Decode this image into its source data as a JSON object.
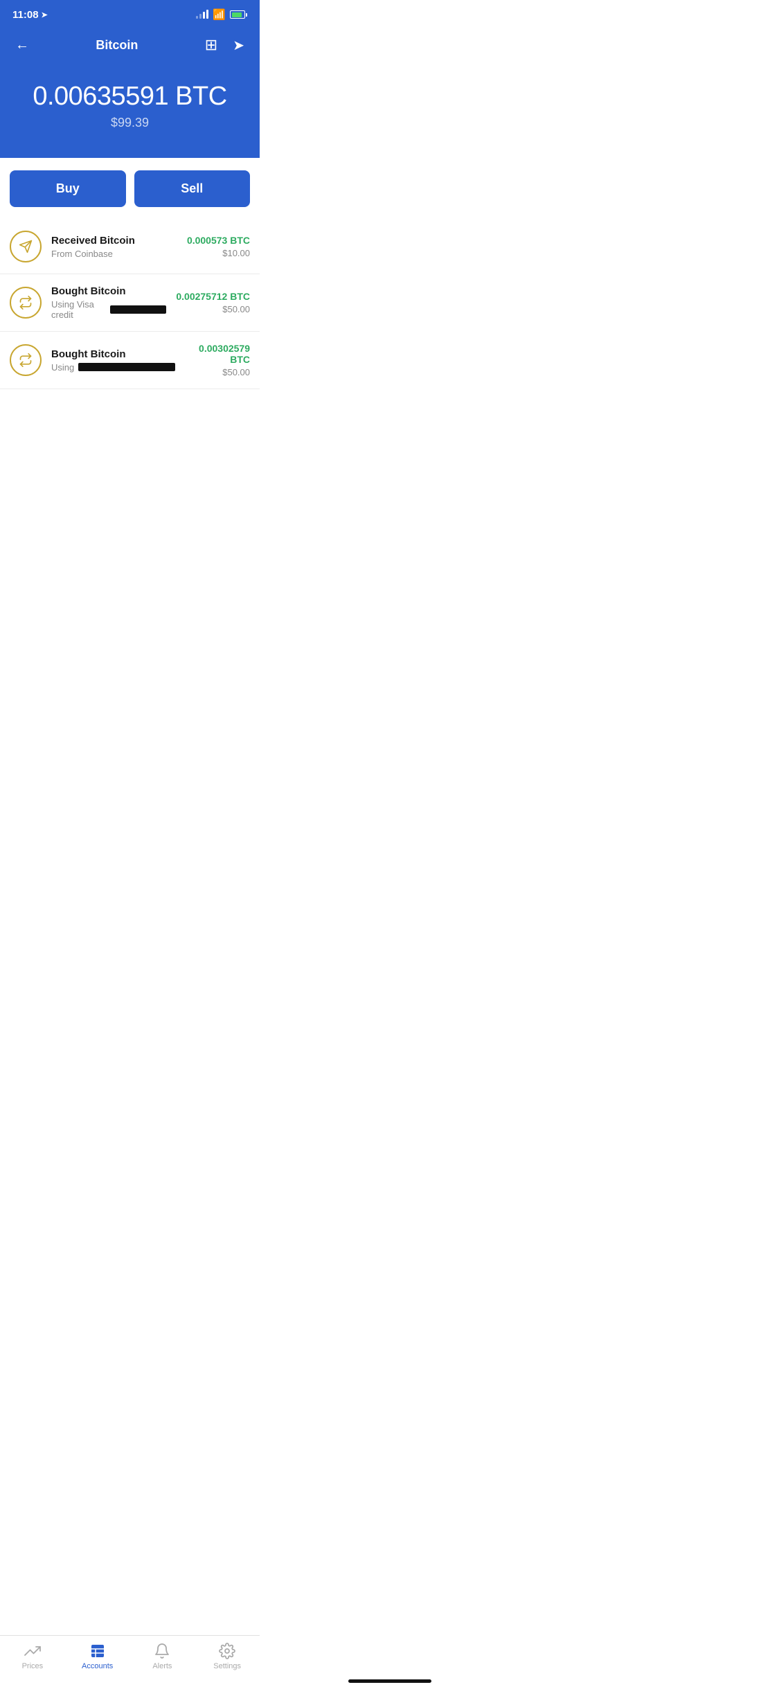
{
  "statusBar": {
    "time": "11:08",
    "locationIcon": "➤"
  },
  "header": {
    "backLabel": "←",
    "title": "Bitcoin",
    "sendIcon": "➤"
  },
  "balance": {
    "btc": "0.00635591 BTC",
    "usd": "$99.39"
  },
  "actions": {
    "buyLabel": "Buy",
    "sellLabel": "Sell"
  },
  "transactions": [
    {
      "type": "receive",
      "title": "Received Bitcoin",
      "subtitle": "From Coinbase",
      "subtitleRedacted": false,
      "btcAmount": "0.000573 BTC",
      "usdAmount": "$10.00"
    },
    {
      "type": "exchange",
      "title": "Bought Bitcoin",
      "subtitle": "Using Visa credit",
      "subtitleRedacted": true,
      "btcAmount": "0.00275712 BTC",
      "usdAmount": "$50.00"
    },
    {
      "type": "exchange",
      "title": "Bought Bitcoin",
      "subtitle": "Using",
      "subtitleRedacted": true,
      "btcAmount": "0.00302579 BTC",
      "usdAmount": "$50.00"
    }
  ],
  "bottomNav": {
    "items": [
      {
        "id": "prices",
        "label": "Prices",
        "active": false
      },
      {
        "id": "accounts",
        "label": "Accounts",
        "active": true
      },
      {
        "id": "alerts",
        "label": "Alerts",
        "active": false
      },
      {
        "id": "settings",
        "label": "Settings",
        "active": false
      }
    ]
  }
}
